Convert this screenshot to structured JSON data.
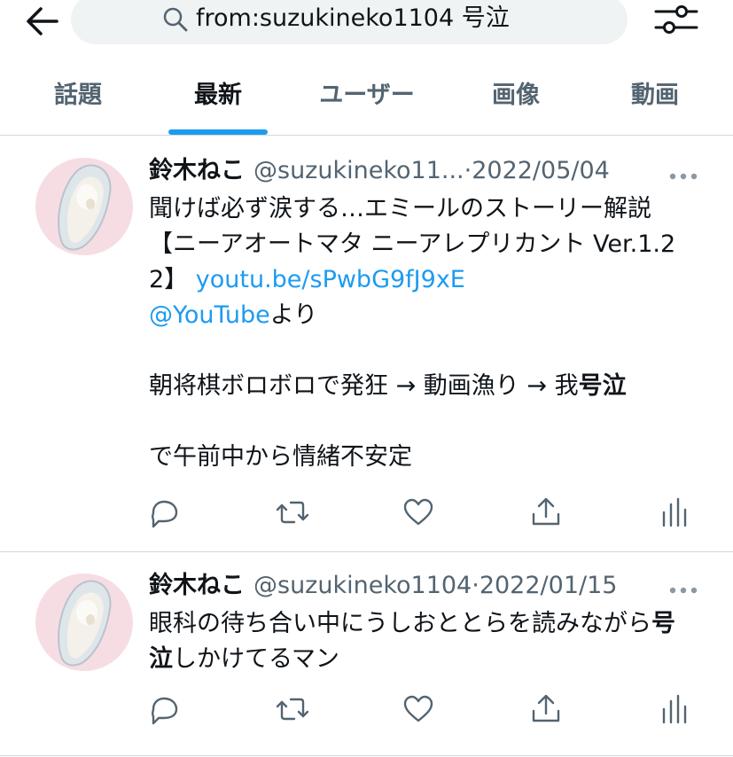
{
  "search": {
    "query": "from:suzukineko1104 号泣"
  },
  "icons": {
    "back": "arrow-left-icon",
    "search": "magnifier-icon",
    "filters": "sliders-icon",
    "more": "more-dots-icon",
    "reply": "reply-icon",
    "retweet": "retweet-icon",
    "like": "heart-icon",
    "share": "share-icon",
    "analytics": "analytics-icon"
  },
  "colors": {
    "accent": "#1d9bf0",
    "secondary_text": "#536471",
    "avatar_bg": "#f6dde3"
  },
  "tabs": [
    {
      "label": "話題",
      "active": false
    },
    {
      "label": "最新",
      "active": true
    },
    {
      "label": "ユーザー",
      "active": false
    },
    {
      "label": "画像",
      "active": false
    },
    {
      "label": "動画",
      "active": false
    }
  ],
  "tweets": [
    {
      "name": "鈴木ねこ",
      "handle": "@suzukineko11...",
      "separator": "·",
      "date": "2022/05/04",
      "text": {
        "part1": "聞けば必ず涙する…エミールのストーリー解説 【ニーアオートマタ ニーアレプリカント Ver.1.22】 ",
        "link1": "youtu.be/sPwbG9fJ9xE",
        "link2": "@YouTube",
        "part2": "より",
        "line2_prefix": "朝将棋ボロボロで発狂 → 動画漁り → 我",
        "line2_bold": "号泣",
        "line3": "で午前中から情緒不安定"
      }
    },
    {
      "name": "鈴木ねこ",
      "handle": "@suzukineko1104",
      "separator": "·",
      "date": "2022/01/15",
      "text": {
        "prefix": "眼科の待ち合い中にうしおととらを読みながら",
        "bold": "号泣",
        "suffix": "しかけてるマン"
      }
    }
  ]
}
